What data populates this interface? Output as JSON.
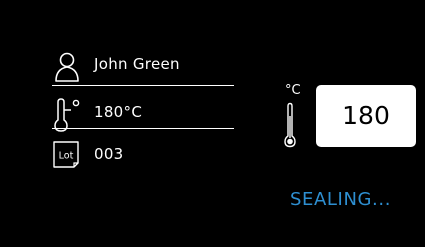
{
  "info": {
    "user": {
      "icon": "user-icon",
      "text": "John Green"
    },
    "temperature": {
      "icon": "thermometer-degree-icon",
      "text": "180°C"
    },
    "lot": {
      "icon": "lot-icon",
      "icon_text": "Lot",
      "text": "003"
    }
  },
  "setpoint": {
    "unit": "°C",
    "icon": "thermometer-icon",
    "value": "180"
  },
  "status": {
    "text": "SEALING...",
    "color": "#2e8fd1"
  },
  "colors": {
    "background": "#000000",
    "foreground": "#ffffff",
    "accent": "#2e8fd1"
  }
}
